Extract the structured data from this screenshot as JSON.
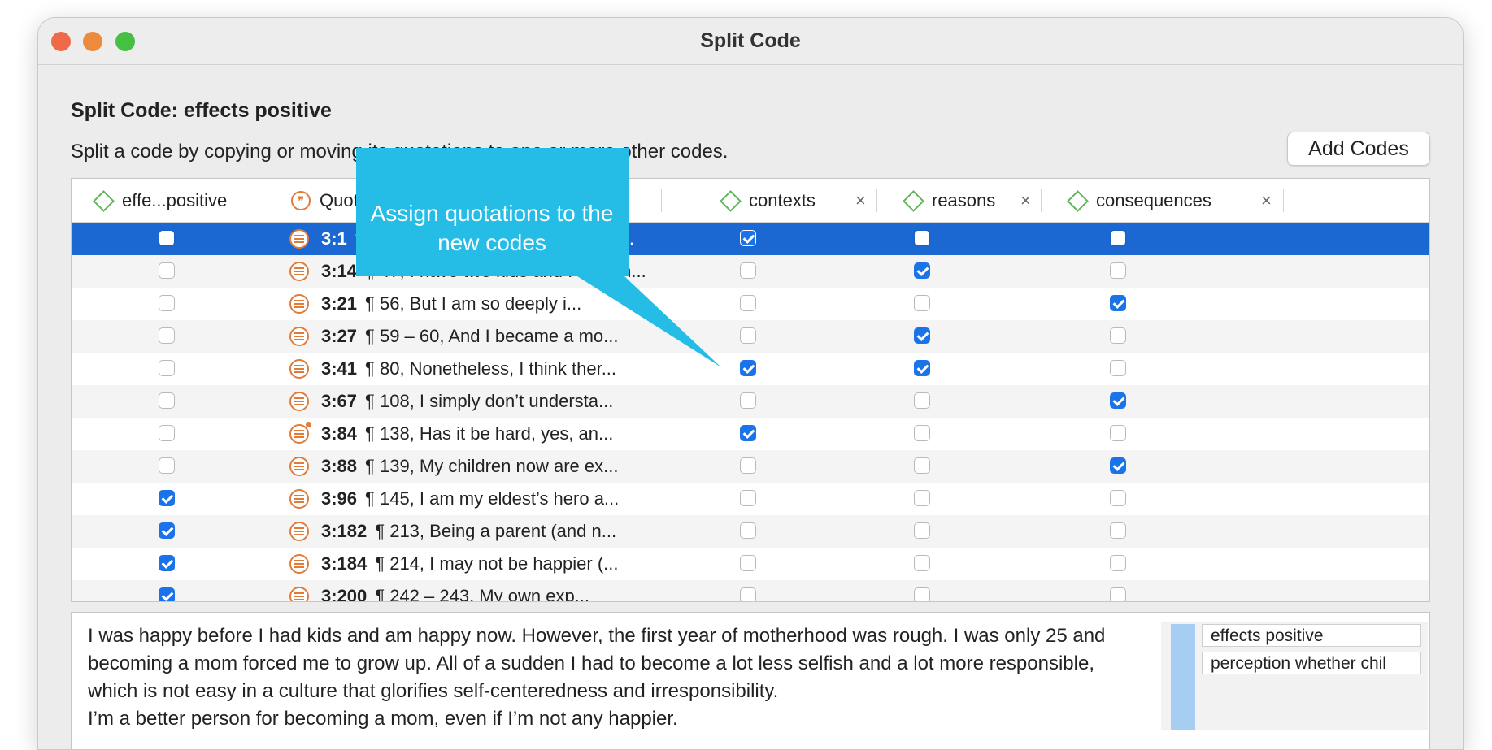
{
  "window": {
    "title": "Split Code"
  },
  "dialog": {
    "title": "Split Code: effects positive",
    "description": "Split a code by copying or moving its quotations to one or more other codes.",
    "add_codes_button": "Add Codes"
  },
  "table": {
    "columns": [
      {
        "label": "effe...positive",
        "icon": "code-diamond-icon",
        "removable": false
      },
      {
        "label": "Quotations",
        "icon": "quotation-icon",
        "removable": false
      },
      {
        "label": "contexts",
        "icon": "code-diamond-icon",
        "removable": true
      },
      {
        "label": "reasons",
        "icon": "code-diamond-icon",
        "removable": true
      },
      {
        "label": "consequences",
        "icon": "code-diamond-icon",
        "removable": true
      }
    ],
    "close_glyph": "×",
    "rows": [
      {
        "id": "3:1",
        "text": "¶ 3, I am the mother of two kids. I...",
        "orig": false,
        "contexts": true,
        "reasons": false,
        "consequences": false,
        "selected": true
      },
      {
        "id": "3:14",
        "text": "¶ 47, I have two kids and I have n...",
        "orig": false,
        "contexts": false,
        "reasons": true,
        "consequences": false
      },
      {
        "id": "3:21",
        "text": "¶ 56, But I am so deeply i...",
        "orig": false,
        "contexts": false,
        "reasons": false,
        "consequences": true
      },
      {
        "id": "3:27",
        "text": "¶ 59 – 60, And I became a mo...",
        "orig": false,
        "contexts": false,
        "reasons": true,
        "consequences": false
      },
      {
        "id": "3:41",
        "text": "¶ 80, Nonetheless, I think ther...",
        "orig": false,
        "contexts": true,
        "reasons": true,
        "consequences": false
      },
      {
        "id": "3:67",
        "text": "¶ 108, I simply don’t understa...",
        "orig": false,
        "contexts": false,
        "reasons": false,
        "consequences": true
      },
      {
        "id": "3:84",
        "text": "¶ 138, Has it be hard, yes, an...",
        "orig": false,
        "contexts": true,
        "reasons": false,
        "consequences": false,
        "memo": true
      },
      {
        "id": "3:88",
        "text": "¶ 139, My children now are ex...",
        "orig": false,
        "contexts": false,
        "reasons": false,
        "consequences": true
      },
      {
        "id": "3:96",
        "text": "¶ 145, I am my eldest’s hero a...",
        "orig": true,
        "contexts": false,
        "reasons": false,
        "consequences": false
      },
      {
        "id": "3:182",
        "text": "¶ 213, Being a parent (and n...",
        "orig": true,
        "contexts": false,
        "reasons": false,
        "consequences": false
      },
      {
        "id": "3:184",
        "text": "¶ 214, I may not be happier (...",
        "orig": true,
        "contexts": false,
        "reasons": false,
        "consequences": false
      },
      {
        "id": "3:200",
        "text": "¶ 242 – 243, My own exp...",
        "orig": true,
        "contexts": false,
        "reasons": false,
        "consequences": false
      }
    ]
  },
  "preview": {
    "text": "I was happy before I had kids and am happy now. However, the first year of motherhood was rough. I was only 25 and becoming a mom forced me to grow up. All of a sudden I had to become a lot less selfish and a lot more responsible, which is not easy in a culture that glorifies self-centeredness and irresponsibility.\nI’m a better person for becoming a mom, even if I’m not any happier.",
    "margin_codes": [
      "effects positive",
      "perception whether chil"
    ]
  },
  "callout": {
    "text": "Assign quotations to the new codes",
    "color": "#25bde6"
  },
  "colors": {
    "selection": "#1b68d3",
    "checkbox_checked": "#1a73e8",
    "code_icon": "#5fb55a",
    "quotation_icon": "#e07b39"
  }
}
